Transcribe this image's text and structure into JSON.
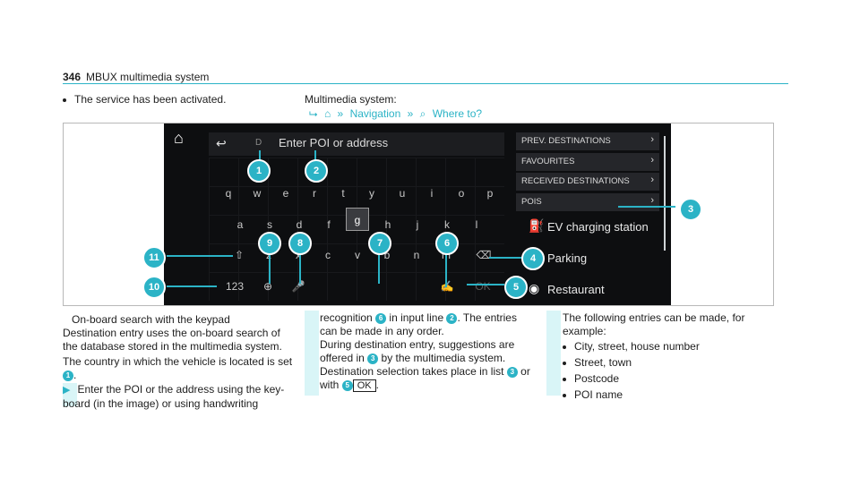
{
  "header": {
    "page_number": "346",
    "title": "MBUX multimedia system"
  },
  "intro": {
    "bullet": "The service has been activated.",
    "system_label": "Multimedia system:",
    "path": [
      "⮡",
      "⌂",
      "»",
      "Navigation",
      "»",
      "⌕",
      "Where to?"
    ]
  },
  "screen": {
    "input_char": "D",
    "input_placeholder": "Enter POI or address",
    "keyboard": {
      "row1": [
        "q",
        "w",
        "e",
        "r",
        "t",
        "y",
        "u",
        "i",
        "o",
        "p"
      ],
      "row2": [
        "a",
        "s",
        "d",
        "f",
        "g",
        "h",
        "j",
        "k",
        "l"
      ],
      "row3": [
        "⇧",
        "z",
        "x",
        "c",
        "v",
        "b",
        "n",
        "m",
        "⌫"
      ],
      "row4": [
        "123",
        "⊕",
        "🎤",
        "✍",
        "OK"
      ]
    },
    "menu_items": [
      "PREV. DESTINATIONS",
      "FAVOURITES",
      "RECEIVED DESTINATIONS",
      "POIS"
    ],
    "poi_items": [
      "EV charging station",
      "Parking",
      "Restaurant"
    ]
  },
  "callouts": [
    "1",
    "2",
    "3",
    "4",
    "5",
    "6",
    "7",
    "8",
    "9",
    "11",
    "10"
  ],
  "col1": {
    "caption": "On-board search with the keypad",
    "text1": "Destination entry uses the on-board search of the database stored in the multimedia system.",
    "text2a": "The country in which the vehicle is located is set",
    "text2_num": "1",
    "text2b": ".",
    "step": "Enter the POI or the address using the key-board (in the image) or using handwriting"
  },
  "col2": {
    "t1": "recognition",
    "n6": "6",
    "t2": "in input line",
    "n2": "2",
    "t3": ". The entries can be made in any order.",
    "t4": "During destination entry, suggestions are offered in",
    "n3": "3",
    "t5": "by the multimedia system. Destination selection takes place in list",
    "n3b": "3",
    "t6": "or with",
    "n5": "5",
    "ok": "OK",
    "t7": "."
  },
  "col3": {
    "text": "The following entries can be made, for example:",
    "items": [
      "City, street, house number",
      "Street, town",
      "Postcode",
      "POI name"
    ]
  }
}
